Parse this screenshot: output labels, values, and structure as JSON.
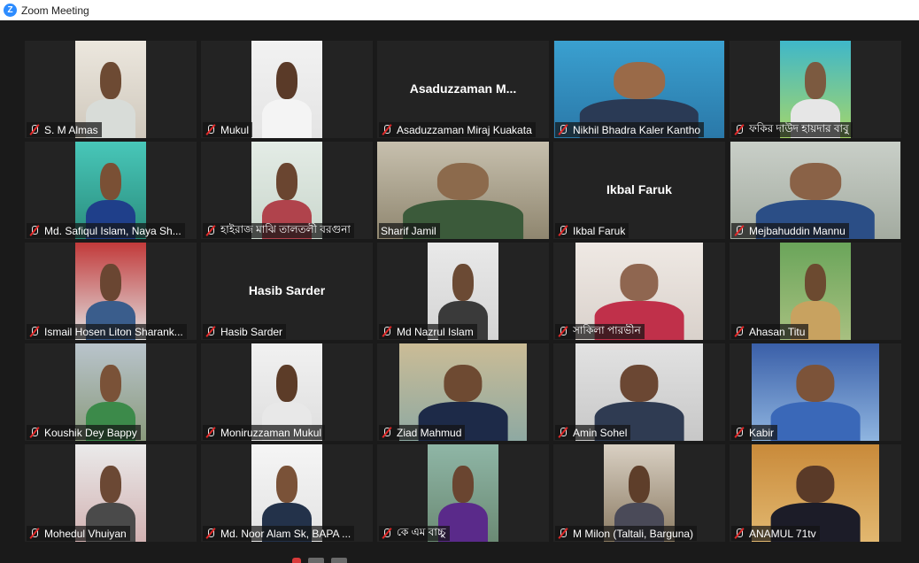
{
  "window": {
    "title": "Zoom Meeting",
    "logo_letter": "Z",
    "logo_icon": "zoom-logo-icon"
  },
  "colors": {
    "tile_bg": "#232323",
    "active_speaker_border": "#b9d94d",
    "mute_red": "#e02828",
    "zoom_blue": "#2d8cff"
  },
  "participants": [
    {
      "name": "S. M Almas",
      "muted": true,
      "video": true
    },
    {
      "name": "Mukul",
      "muted": true,
      "video": true
    },
    {
      "name": "Asaduzzaman Miraj Kuakata",
      "display": "Asaduzzaman  M...",
      "muted": true,
      "video": false
    },
    {
      "name": "Nikhil Bhadra Kaler Kantho",
      "muted": true,
      "video": true
    },
    {
      "name": "ফকির দাউদ হায়দার বাবু",
      "muted": true,
      "video": true
    },
    {
      "name": "Md. Safiqul Islam, Naya Sh...",
      "muted": true,
      "video": true
    },
    {
      "name": "হাইরাজ মাঝি তালতলী বরগুনা",
      "muted": true,
      "video": true
    },
    {
      "name": "Sharif Jamil",
      "muted": false,
      "video": true,
      "active_speaker": true
    },
    {
      "name": "Ikbal Faruk",
      "display": "Ikbal Faruk",
      "muted": true,
      "video": false
    },
    {
      "name": "Mejbahuddin Mannu",
      "muted": true,
      "video": true
    },
    {
      "name": "Ismail Hosen Liton Sharank...",
      "muted": true,
      "video": true
    },
    {
      "name": "Hasib Sarder",
      "display": "Hasib Sarder",
      "muted": true,
      "video": false
    },
    {
      "name": "Md Nazrul Islam",
      "muted": true,
      "video": true
    },
    {
      "name": "সাকিলা পারভীন",
      "muted": true,
      "video": true
    },
    {
      "name": "Ahasan Titu",
      "muted": true,
      "video": true
    },
    {
      "name": "Koushik Dey Bappy",
      "muted": true,
      "video": true
    },
    {
      "name": "Moniruzzaman Mukul",
      "muted": true,
      "video": true
    },
    {
      "name": "Ziad Mahmud",
      "muted": true,
      "video": true
    },
    {
      "name": "Amin Sohel",
      "muted": true,
      "video": true
    },
    {
      "name": "Kabir",
      "muted": true,
      "video": true
    },
    {
      "name": "Mohedul Vhuiyan",
      "muted": true,
      "video": true
    },
    {
      "name": "Md. Noor Alam Sk, BAPA ...",
      "muted": true,
      "video": true
    },
    {
      "name": "কে এম বাচ্চু",
      "muted": true,
      "video": true
    },
    {
      "name": "M Milon (Taltali, Barguna)",
      "muted": true,
      "video": true
    },
    {
      "name": "ANAMUL 71tv",
      "muted": true,
      "video": true
    }
  ],
  "icons": {
    "mute": "microphone-muted-icon"
  }
}
